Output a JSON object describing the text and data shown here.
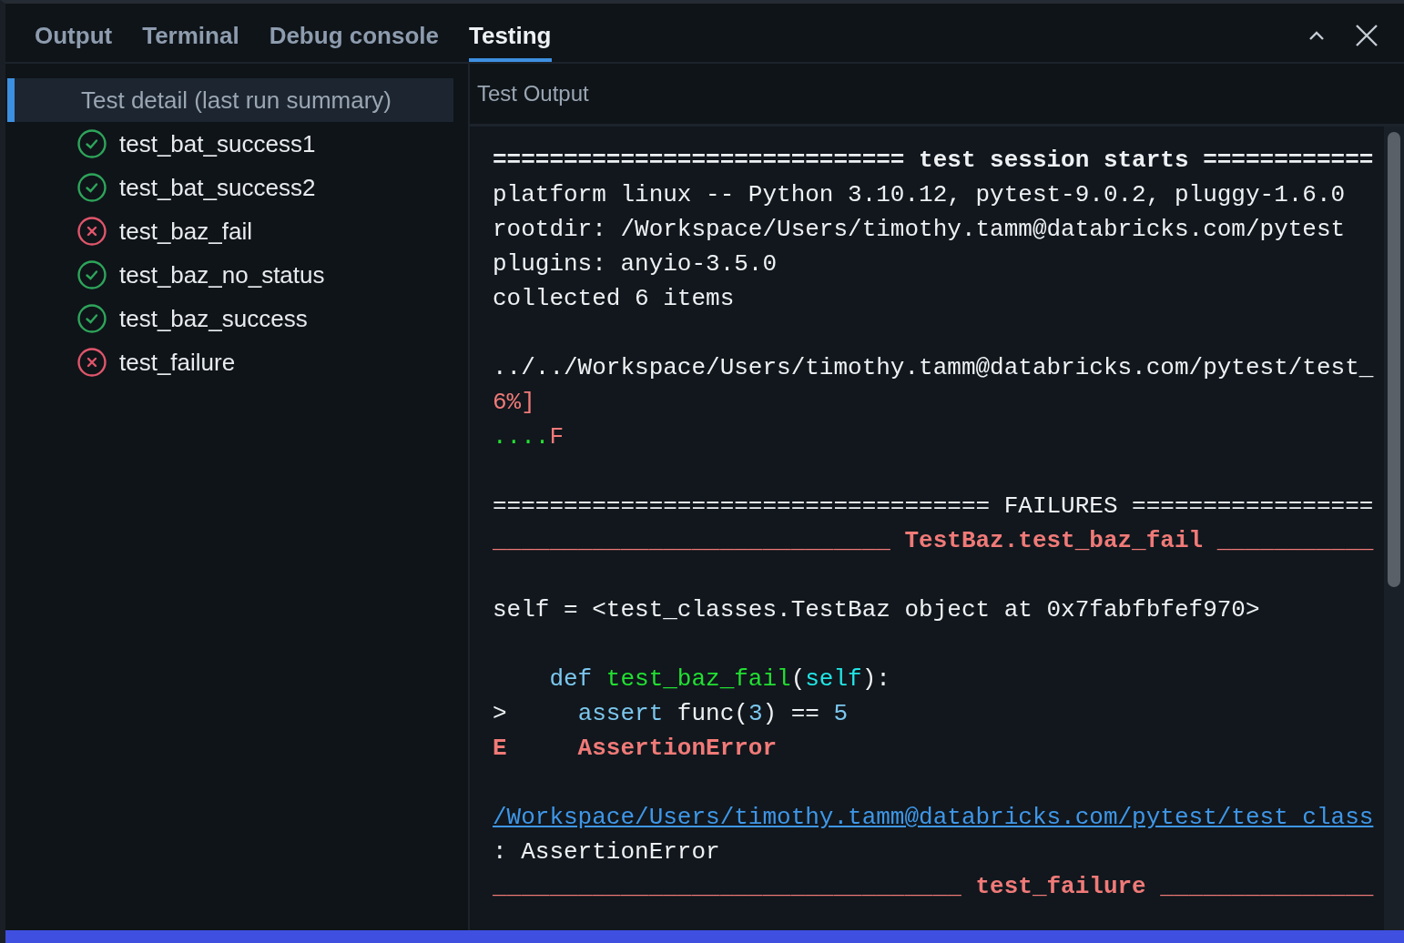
{
  "tabs": [
    {
      "label": "Output",
      "selected": false
    },
    {
      "label": "Terminal",
      "selected": false
    },
    {
      "label": "Debug console",
      "selected": false
    },
    {
      "label": "Testing",
      "selected": true
    }
  ],
  "sidebar": {
    "header": {
      "label": "Test detail (last run summary)",
      "selected": true
    },
    "items": [
      {
        "label": "test_bat_success1",
        "kind": "passed",
        "selected": false
      },
      {
        "label": "test_bat_success2",
        "kind": "passed",
        "selected": false
      },
      {
        "label": "test_baz_fail",
        "kind": "failed",
        "selected": false
      },
      {
        "label": "test_baz_no_status",
        "kind": "passed",
        "selected": false
      },
      {
        "label": "test_baz_success",
        "kind": "passed",
        "selected": false
      },
      {
        "label": "test_failure",
        "kind": "failed",
        "selected": false
      }
    ]
  },
  "output": {
    "title": "Test Output",
    "blocks": [
      [
        [
          {
            "text": "============================= test session starts ============",
            "kind": "bold"
          }
        ],
        [
          {
            "text": "platform linux -- Python 3.10.12, pytest-9.0.2, pluggy-1.6.0",
            "kind": "plain"
          }
        ],
        [
          {
            "text": "rootdir: /Workspace/Users/timothy.tamm@databricks.com/pytest",
            "kind": "plain"
          }
        ],
        [
          {
            "text": "plugins: anyio-3.5.0",
            "kind": "plain"
          }
        ],
        [
          {
            "text": "collected 6 items",
            "kind": "plain"
          }
        ]
      ],
      [
        [
          {
            "text": "../../Workspace/Users/timothy.tamm@databricks.com/pytest/test_",
            "kind": "plain"
          }
        ],
        [
          {
            "text": "6%]",
            "kind": "red"
          }
        ],
        [
          {
            "text": "....",
            "kind": "green"
          },
          {
            "text": "F",
            "kind": "red"
          }
        ]
      ],
      [
        [
          {
            "text": "=================================== FAILURES =================",
            "kind": "plain"
          }
        ],
        [
          {
            "text": "____________________________ TestBaz.test_baz_fail ___________",
            "kind": "error"
          }
        ]
      ],
      [
        [
          {
            "text": "self = <test_classes.TestBaz object at 0x7fabfbfef970>",
            "kind": "plain"
          }
        ]
      ],
      [
        [
          {
            "text": "    def",
            "kind": "keyword"
          },
          {
            "text": " test_baz_fail",
            "kind": "green"
          },
          {
            "text": "(",
            "kind": "plain"
          },
          {
            "text": "self",
            "kind": "cyan"
          },
          {
            "text": "):",
            "kind": "plain"
          }
        ],
        [
          {
            "text": ">     ",
            "kind": "plain"
          },
          {
            "text": "assert",
            "kind": "keyword"
          },
          {
            "text": " func(",
            "kind": "plain"
          },
          {
            "text": "3",
            "kind": "keyword"
          },
          {
            "text": ") == ",
            "kind": "plain"
          },
          {
            "text": "5",
            "kind": "keyword"
          }
        ],
        [
          {
            "text": "E     AssertionError",
            "kind": "error"
          }
        ]
      ],
      [
        [
          {
            "text": "/Workspace/Users/timothy.tamm@databricks.com/pytest/test_class",
            "kind": "link"
          }
        ],
        [
          {
            "text": ": AssertionError",
            "kind": "plain"
          }
        ],
        [
          {
            "text": "_________________________________ test_failure _______________",
            "kind": "error"
          }
        ]
      ]
    ]
  }
}
